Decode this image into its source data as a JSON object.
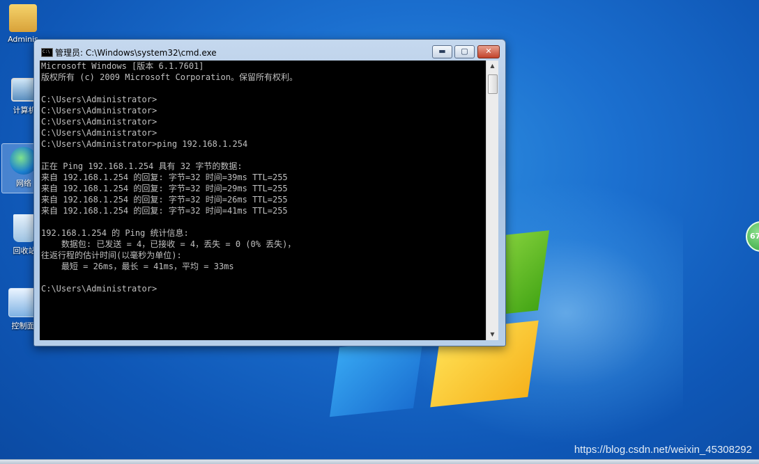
{
  "desktop": {
    "icons": [
      {
        "label": "Adminis",
        "icon": "user-folder-icon"
      },
      {
        "label": "计算机",
        "icon": "computer-icon"
      },
      {
        "label": "网络",
        "icon": "network-icon"
      },
      {
        "label": "回收站",
        "icon": "recycle-bin-icon"
      },
      {
        "label": "控制面",
        "icon": "control-panel-icon"
      }
    ],
    "badge_text": "67",
    "watermark": "https://blog.csdn.net/weixin_45308292"
  },
  "window": {
    "title": "管理员: C:\\Windows\\system32\\cmd.exe",
    "title_icon_text": "C:\\",
    "controls": {
      "minimize": "▬",
      "maximize": "▢",
      "close": "✕"
    }
  },
  "console": {
    "lines": [
      "Microsoft Windows [版本 6.1.7601]",
      "版权所有 (c) 2009 Microsoft Corporation。保留所有权利。",
      "",
      "C:\\Users\\Administrator>",
      "C:\\Users\\Administrator>",
      "C:\\Users\\Administrator>",
      "C:\\Users\\Administrator>",
      "C:\\Users\\Administrator>ping 192.168.1.254",
      "",
      "正在 Ping 192.168.1.254 具有 32 字节的数据:",
      "来自 192.168.1.254 的回复: 字节=32 时间=39ms TTL=255",
      "来自 192.168.1.254 的回复: 字节=32 时间=29ms TTL=255",
      "来自 192.168.1.254 的回复: 字节=32 时间=26ms TTL=255",
      "来自 192.168.1.254 的回复: 字节=32 时间=41ms TTL=255",
      "",
      "192.168.1.254 的 Ping 统计信息:",
      "    数据包: 已发送 = 4，已接收 = 4，丢失 = 0 (0% 丢失)，",
      "往返行程的估计时间(以毫秒为单位):",
      "    最短 = 26ms，最长 = 41ms，平均 = 33ms",
      "",
      "C:\\Users\\Administrator>"
    ]
  },
  "scrollbar": {
    "up": "▲",
    "down": "▼"
  }
}
